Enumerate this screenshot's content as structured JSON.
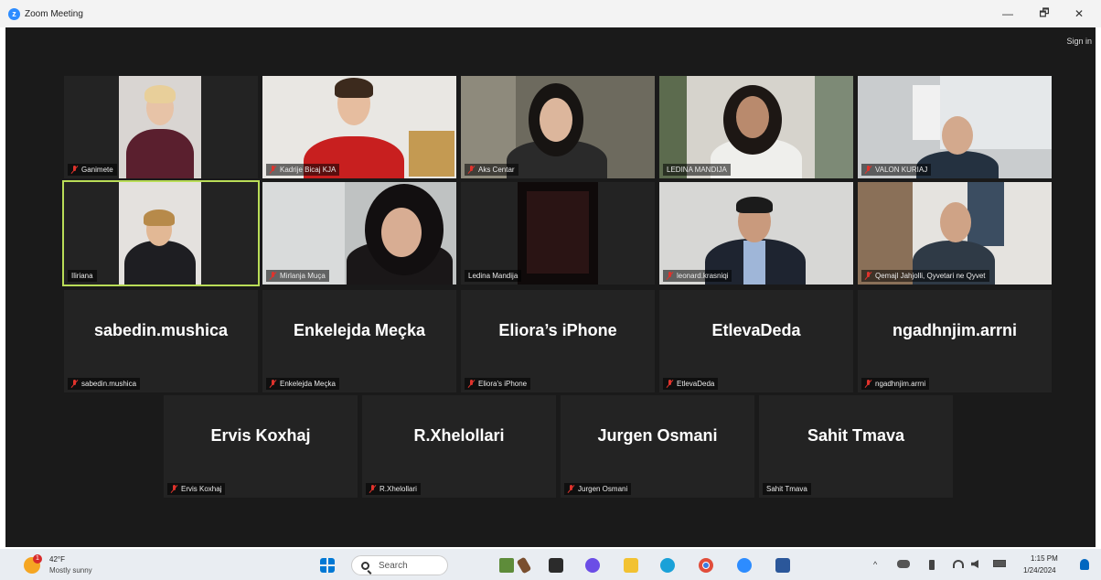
{
  "window": {
    "title": "Zoom Meeting",
    "minimize": "—",
    "restore": "🗗",
    "close": "✕",
    "sign_in": "Sign in"
  },
  "video_tiles": [
    {
      "name": "Ganimete",
      "muted": true
    },
    {
      "name": "Kadrije Bicaj KJA",
      "muted": true
    },
    {
      "name": "Aks Centar",
      "muted": true
    },
    {
      "name": "LEDINA MANDIJA",
      "muted": false
    },
    {
      "name": "VALON KURIAJ",
      "muted": true
    },
    {
      "name": "Iliriana",
      "muted": false,
      "active": true
    },
    {
      "name": "Mirlanja Muça",
      "muted": true
    },
    {
      "name": "Ledina Mandija",
      "muted": false
    },
    {
      "name": "leonard.krasniqi",
      "muted": true
    },
    {
      "name": "Qemajl Jahjolli, Qyvetari ne Qyvet",
      "muted": true
    }
  ],
  "name_tiles_row3": [
    {
      "display": "sabedin.mushica",
      "tag": "sabedin.mushica",
      "muted": true
    },
    {
      "display": "Enkelejda Meçka",
      "tag": "Enkelejda Meçka",
      "muted": true
    },
    {
      "display": "Eliora’s iPhone",
      "tag": "Eliora's iPhone",
      "muted": true
    },
    {
      "display": "EtlevaDeda",
      "tag": "EtlevaDeda",
      "muted": true
    },
    {
      "display": "ngadhnjim.arrni",
      "tag": "ngadhnjim.arrni",
      "muted": true
    }
  ],
  "name_tiles_row4": [
    {
      "display": "Ervis Koxhaj",
      "tag": "Ervis Koxhaj",
      "muted": true
    },
    {
      "display": "R.Xhelollari",
      "tag": "R.Xhelollari",
      "muted": true
    },
    {
      "display": "Jurgen Osmani",
      "tag": "Jurgen Osmani",
      "muted": true
    },
    {
      "display": "Sahit Tmava",
      "tag": "Sahit Tmava",
      "muted": false
    }
  ],
  "taskbar": {
    "weather_badge": "1",
    "temperature": "42°F",
    "condition": "Mostly sunny",
    "search_placeholder": "Search",
    "time": "1:15 PM",
    "date": "1/24/2024",
    "chevron": "^",
    "accent": "#0067c0"
  }
}
